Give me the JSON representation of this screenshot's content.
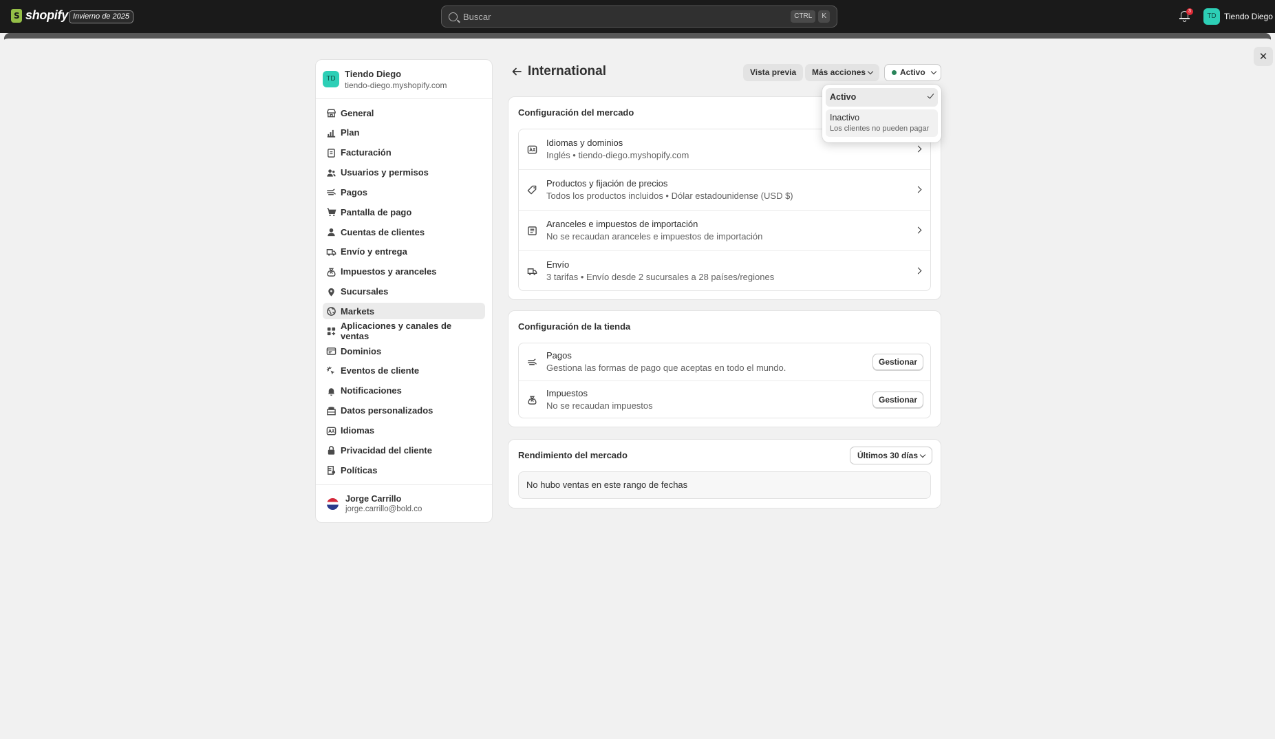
{
  "topbar": {
    "logo_text": "shopify",
    "edition": "Invierno de 2025",
    "search_placeholder": "Buscar",
    "shortcut": [
      "CTRL",
      "K"
    ],
    "notification_count": "3",
    "store_initials": "TD",
    "store_name": "Tiendo Diego"
  },
  "sidebar": {
    "store": {
      "initials": "TD",
      "name": "Tiendo Diego",
      "url": "tiendo-diego.myshopify.com"
    },
    "items": [
      {
        "label": "General",
        "icon": "store-icon"
      },
      {
        "label": "Plan",
        "icon": "plan-chart-icon"
      },
      {
        "label": "Facturación",
        "icon": "billing-icon"
      },
      {
        "label": "Usuarios y permisos",
        "icon": "users-icon"
      },
      {
        "label": "Pagos",
        "icon": "payments-icon"
      },
      {
        "label": "Pantalla de pago",
        "icon": "cart-icon"
      },
      {
        "label": "Cuentas de clientes",
        "icon": "person-icon"
      },
      {
        "label": "Envío y entrega",
        "icon": "truck-icon"
      },
      {
        "label": "Impuestos y aranceles",
        "icon": "tax-bag-icon"
      },
      {
        "label": "Sucursales",
        "icon": "location-pin-icon"
      },
      {
        "label": "Markets",
        "icon": "globe-icon",
        "active": true
      },
      {
        "label": "Aplicaciones y canales de ventas",
        "icon": "apps-icon"
      },
      {
        "label": "Dominios",
        "icon": "domain-icon"
      },
      {
        "label": "Eventos de cliente",
        "icon": "cursor-icon"
      },
      {
        "label": "Notificaciones",
        "icon": "bell-icon"
      },
      {
        "label": "Datos personalizados",
        "icon": "database-icon"
      },
      {
        "label": "Idiomas",
        "icon": "language-icon"
      },
      {
        "label": "Privacidad del cliente",
        "icon": "lock-icon"
      },
      {
        "label": "Políticas",
        "icon": "policy-icon"
      }
    ],
    "user": {
      "name": "Jorge Carrillo",
      "email": "jorge.carrillo@bold.co"
    }
  },
  "header": {
    "title": "International",
    "preview_label": "Vista previa",
    "more_actions_label": "Más acciones",
    "status_label": "Activo"
  },
  "status_menu": {
    "options": [
      {
        "label": "Activo",
        "selected": true
      },
      {
        "label": "Inactivo",
        "help": "Los clientes no pueden pagar"
      }
    ]
  },
  "market_config": {
    "title": "Configuración del mercado",
    "rows": [
      {
        "icon": "language-icon",
        "title": "Idiomas y dominios",
        "subtitle": "Inglés • tiendo-diego.myshopify.com"
      },
      {
        "icon": "price-tag-icon",
        "title": "Productos y fijación de precios",
        "subtitle": "Todos los productos incluidos • Dólar estadounidense (USD $)"
      },
      {
        "icon": "duties-icon",
        "title": "Aranceles e impuestos de importación",
        "subtitle": "No se recaudan aranceles e impuestos de importación"
      },
      {
        "icon": "truck-icon",
        "title": "Envío",
        "subtitle": "3 tarifas • Envío desde 2 sucursales a 28 países/regiones"
      }
    ]
  },
  "store_config": {
    "title": "Configuración de la tienda",
    "rows": [
      {
        "icon": "payments-icon",
        "title": "Pagos",
        "subtitle": "Gestiona las formas de pago que aceptas en todo el mundo.",
        "action": "Gestionar"
      },
      {
        "icon": "tax-bag-icon",
        "title": "Impuestos",
        "subtitle": "No se recaudan impuestos",
        "action": "Gestionar"
      }
    ]
  },
  "performance": {
    "title": "Rendimiento del mercado",
    "range_label": "Últimos 30 días",
    "empty_message": "No hubo ventas en este rango de fechas"
  },
  "colors": {
    "topbar_bg": "#1a1a1a",
    "page_bg": "#f1f1f1",
    "avatar": "#2dcfb6",
    "active_dot": "#29845a",
    "badge": "#e22c38"
  }
}
